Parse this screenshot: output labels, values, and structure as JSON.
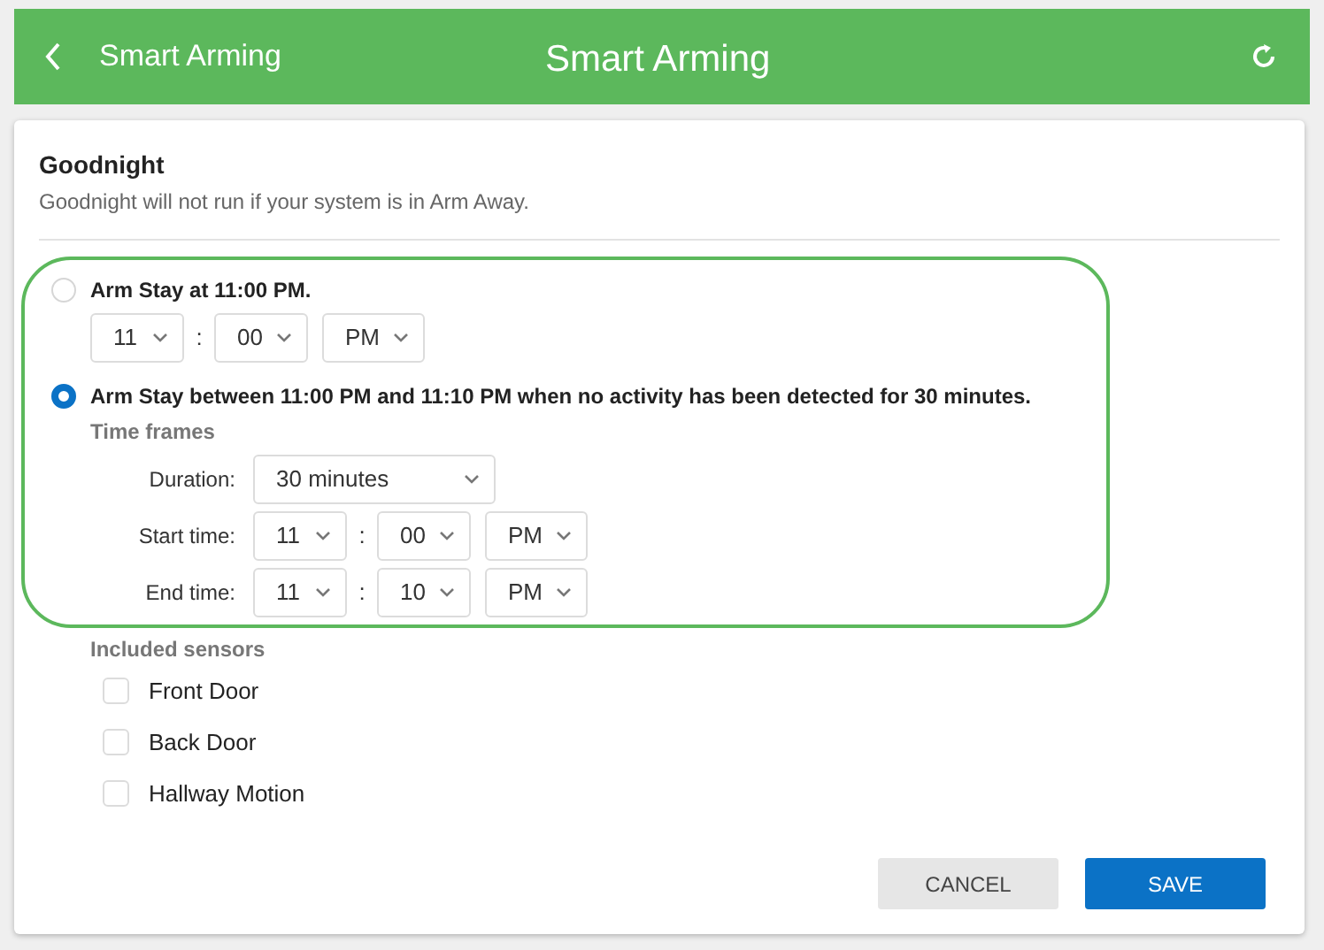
{
  "header": {
    "back_label": "Smart Arming",
    "title": "Smart Arming"
  },
  "section": {
    "title": "Goodnight",
    "description": "Goodnight will not run if your system is in Arm Away."
  },
  "options": [
    {
      "kind": "time",
      "label": "Arm Stay at 11:00 PM.",
      "selected": false,
      "hour": "11",
      "separator": ":",
      "minute": "00",
      "period": "PM"
    },
    {
      "kind": "window",
      "label": "Arm Stay between 11:00 PM and 11:10 PM when no activity has been detected for 30 minutes.",
      "selected": true,
      "subheading": "Time frames",
      "fields": [
        {
          "kind": "select",
          "label": "Duration:",
          "value": "30 minutes"
        },
        {
          "kind": "time",
          "label": "Start time:",
          "hour": "11",
          "separator": ":",
          "minute": "00",
          "period": "PM"
        },
        {
          "kind": "time",
          "label": "End time:",
          "hour": "11",
          "separator": ":",
          "minute": "10",
          "period": "PM"
        }
      ]
    }
  ],
  "sensors": {
    "heading": "Included sensors",
    "items": [
      {
        "label": "Front Door",
        "checked": false
      },
      {
        "label": "Back Door",
        "checked": false
      },
      {
        "label": "Hallway Motion",
        "checked": false
      }
    ]
  },
  "buttons": [
    {
      "kind": "secondary",
      "label": "CANCEL"
    },
    {
      "kind": "primary",
      "label": "SAVE"
    }
  ]
}
